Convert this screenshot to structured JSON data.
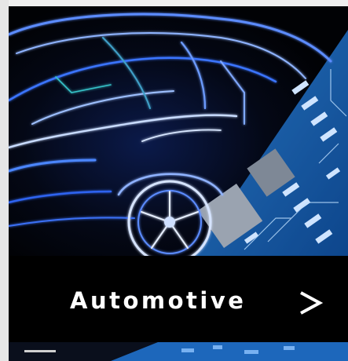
{
  "card": {
    "label": "Automotive",
    "arrow_icon": "chevron-right-icon"
  },
  "colors": {
    "background": "#e9e9e9",
    "band": "#000000",
    "text": "#ffffff",
    "car_glow": "#3b74ff",
    "pcb_blue": "#1f6fc4"
  }
}
